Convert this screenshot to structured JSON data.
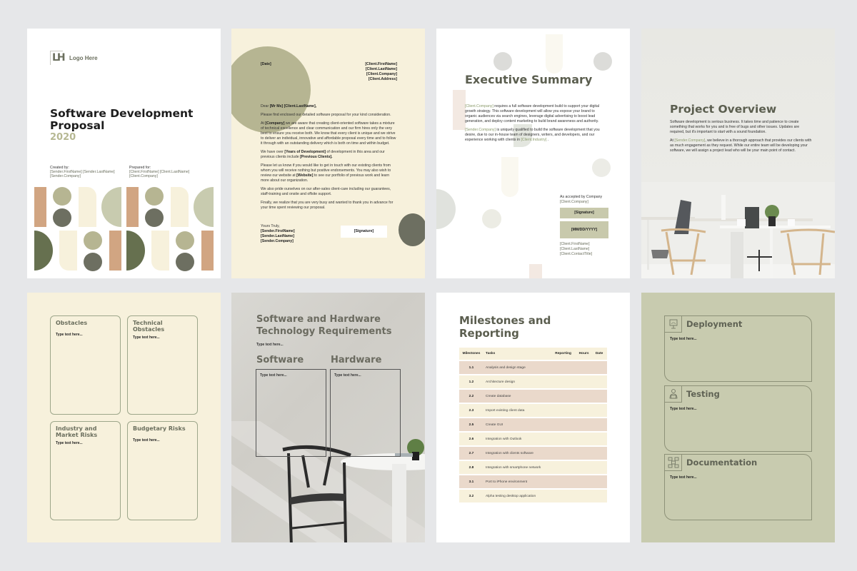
{
  "colors": {
    "background": "#e6e7e9",
    "cream": "#f7f1dc",
    "olive": "#b6b592",
    "dark_olive": "#6d6f61",
    "sage": "#c8cbaf",
    "terracotta": "#d1a582",
    "forest": "#66704f",
    "heading": "#5b5e4f"
  },
  "cover": {
    "logo_mark": "LH",
    "logo_text": "Logo Here",
    "title": "Software Development Proposal",
    "year": "2020",
    "created_label": "Created by:",
    "created_name": "[Sender.FirstName] [Sender.LastName]",
    "created_company": "[Sender.Company]",
    "prepared_label": "Prepared for:",
    "prepared_name": "[Client.FirstName] [Client.LastName]",
    "prepared_company": "[Client.Company]"
  },
  "letter": {
    "date": "[Date]",
    "client_first": "[Client.FirstName]",
    "client_last": "[Client.LastName]",
    "client_company": "[Client.Company]",
    "client_address": "[Client.Address]",
    "greeting_prefix": "Dear ",
    "greeting_name": "[Mr Ms] [Client.LastName],",
    "p1": "Please find enclosed our detailed software proposal for your kind consideration.",
    "p2_pre": "At ",
    "p2_bold": "[Company]",
    "p2_post": " we are aware that creating client-oriented software takes a mixture of technical excellence and clear communication and our firm hires only the very best to ensure you receive both. We know that every client is unique and we strive to deliver an individual, innovative and affordable proposal every time and to follow it through with an outstanding delivery which is both on time and within budget.",
    "p3_pre": "We have over ",
    "p3_bold1": "[Years of Development]",
    "p3_mid": " of development in this area and our previous clients include ",
    "p3_bold2": "[Previous Clients].",
    "p4_pre": "Please let us know if you would like to get in touch with our existing clients from whom you will receive nothing but positive endorsements. You may also wish to review our website at ",
    "p4_bold": "[Website]",
    "p4_post": " to see our portfolio of previous work and learn more about our organization.",
    "p5": "We also pride ourselves on our after-sales client-care including our guarantees, staff-training and onsite and offsite support.",
    "p6": "Finally, we realize that you are very busy and wanted to thank you in advance for your time spent reviewing our proposal.",
    "closing": "Yours Truly,",
    "sender_first": "[Sender.FirstName]",
    "sender_last": "[Sender.LastName]",
    "sender_company": "[Sender.Company]",
    "signature": "[Signature]"
  },
  "executive": {
    "heading": "Executive Summary",
    "p1_tag": "[Client.Company]",
    "p1": " requires a full software development build to support your digital growth strategy. This software development will allow you expose your brand to organic audiences via search engines, leverage digital advertising to boost lead generation, and deploy content marketing to build brand awareness and authority.",
    "p2_tag": "[Sender.Company]",
    "p2": " is uniquely qualified to build the software development that you desire, due to our in-house team of designers, writers, and developers, and our experience working with clients in ",
    "p2_tag2": "[Client.Industry]",
    "p2_end": " .",
    "accepted_label": "As accepted by Company",
    "accepted_company": "[Client.Company]",
    "signature": "[Signature]",
    "date": "[MM/DD/YYYY]",
    "contact_first": "[Client.FirstName]",
    "contact_last": "[Client.LastName]",
    "contact_title": "[Client.ContactTitle]"
  },
  "overview": {
    "heading": "Project Overview",
    "p1": "Software development is serious business. It takes time and patience to create something that works for you and is free of bugs and other issues. Updates are required, but it's important to start with a sound foundation.",
    "p2_pre": "At ",
    "p2_tag": "[Sender.Company]",
    "p2_post": ", we believe in a thorough approach that provides our clients with as much engagement as they request. While our entire team will be developing your software, we will assign a project lead who will be your main point of contact."
  },
  "obstacles": {
    "boxes": [
      {
        "title": "Obstacles",
        "text": "Type text here..."
      },
      {
        "title": "Technical Obstacles",
        "text": "Type text here..."
      },
      {
        "title": "Industry and Market Risks",
        "text": "Type text here..."
      },
      {
        "title": "Budgetary Risks",
        "text": "Type text here..."
      }
    ]
  },
  "requirements": {
    "heading": "Software and Hardware Technology Requirements",
    "intro": "Type text here...",
    "software_label": "Software",
    "software_text": "Type text here...",
    "hardware_label": "Hardware",
    "hardware_text": "Type text here..."
  },
  "milestones": {
    "heading": "Milestones and Reporting",
    "columns": [
      "Milestones",
      "Tasks",
      "Reporting",
      "Hours",
      "Date"
    ],
    "rows": [
      {
        "id": "1.1",
        "task": "Analysis and design stage"
      },
      {
        "id": "1.2",
        "task": "Architecture design"
      },
      {
        "id": "2.2",
        "task": "Create database"
      },
      {
        "id": "2.3",
        "task": "Import existing client data"
      },
      {
        "id": "2.5",
        "task": "Create GUI"
      },
      {
        "id": "2.6",
        "task": "Integration with Outlook"
      },
      {
        "id": "2.7",
        "task": "Integration with clients software"
      },
      {
        "id": "2.8",
        "task": "Integration with smartphone network"
      },
      {
        "id": "3.1",
        "task": "Port to iPhone environment"
      },
      {
        "id": "3.2",
        "task": "Alpha testing desktop application"
      }
    ]
  },
  "deployment": {
    "sections": [
      {
        "title": "Deployment",
        "text": "Type text here...",
        "icon": "presentation-icon"
      },
      {
        "title": "Testing",
        "text": "Type text here...",
        "icon": "person-laptop-icon"
      },
      {
        "title": "Documentation",
        "text": "Type text here...",
        "icon": "flowchart-icon"
      }
    ]
  }
}
